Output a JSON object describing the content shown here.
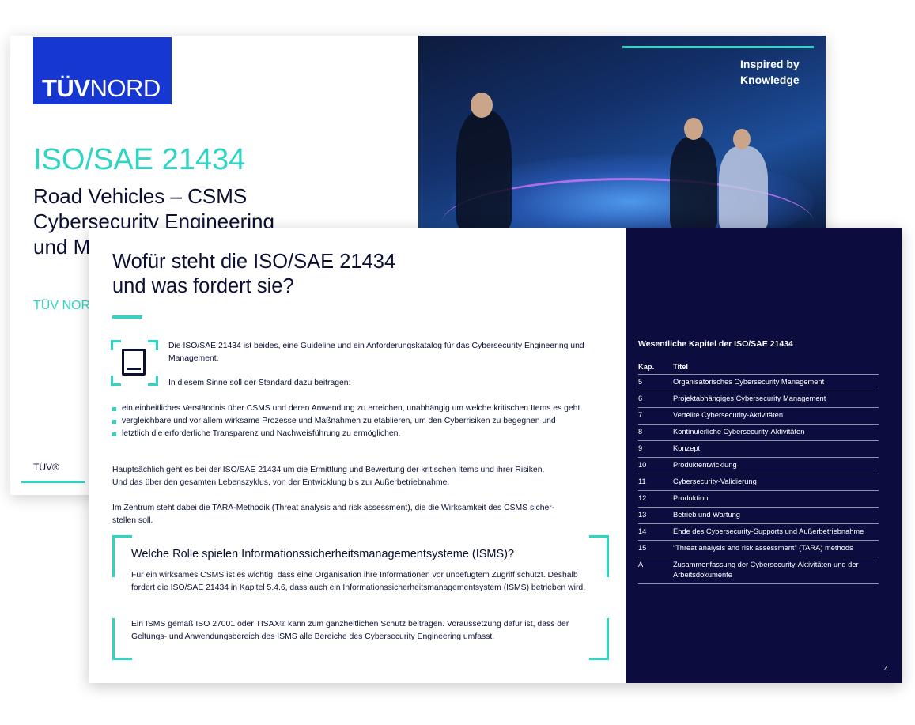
{
  "cover": {
    "logo_bold": "TÜV",
    "logo_regular": "NORD",
    "title": "ISO/SAE 21434",
    "subtitle_lines": [
      "Road Vehicles – CSMS",
      "Cybersecurity Engineering",
      "und M"
    ],
    "org_partial": "TÜV NOR",
    "footer": "TÜV®",
    "tagline_line1": "Inspired by",
    "tagline_line2": "Knowledge",
    "colors": {
      "accent": "#2fd4c3",
      "logo_blue": "#1737d2",
      "navy": "#0b0d3e"
    }
  },
  "page": {
    "heading_line1": "Wofür steht die ISO/SAE 21434",
    "heading_line2": "und was fordert sie?",
    "icon": "book-icon",
    "intro": "Die ISO/SAE 21434 ist beides, eine Guideline und ein Anforderungskatalog für das Cybersecurity Engineering und Management.",
    "lead": "In diesem Sinne soll der Standard dazu beitragen:",
    "bullets": [
      "ein einheitliches Verständnis über CSMS und deren Anwendung zu erreichen, unabhängig um welche kritischen Items es geht",
      "vergleichbare und vor allem wirksame Prozesse und Maßnahmen zu etablieren, um den Cyberrisiken zu begegnen und",
      "letztlich die erforderliche Transparenz und Nachweisführung zu ermöglichen."
    ],
    "para_main_line1": "Hauptsächlich geht es bei der ISO/SAE 21434 um die Ermittlung und Bewertung der kritischen Items und ihrer Risiken.",
    "para_main_line2": "Und das über den gesamten Lebenszyklus, von der Entwicklung bis zur Außerbetriebnahme.",
    "para_tara_line1": "Im Zentrum steht dabei die TARA-Methodik (Threat analysis and risk assessment), die die Wirksamkeit des CSMS sicher-",
    "para_tara_line2": "stellen soll.",
    "isms": {
      "heading": "Welche Rolle spielen Informationssicherheitsmanagementsysteme (ISMS)?",
      "text1": "Für ein wirksames CSMS ist es wichtig, dass eine Organisation ihre Informationen vor unbefugtem Zugriff schützt. Deshalb fordert die ISO/SAE 21434 in Kapitel 5.4.6, dass auch ein Informationssicherheitsmanagementsystem (ISMS) betrieben wird.",
      "text2": "Ein ISMS gemäß ISO 27001 oder TISAX® kann zum ganzheitlichen Schutz beitragen. Voraussetzung dafür ist, dass der Geltungs- und Anwendungsbereich des ISMS alle Bereiche des Cybersecurity Engineering umfasst."
    },
    "chapters": {
      "title": "Wesentliche Kapitel der ISO/SAE 21434",
      "col_kap": "Kap.",
      "col_titel": "Titel",
      "rows": [
        {
          "kap": "5",
          "titel": "Organisatorisches Cybersecurity Management"
        },
        {
          "kap": "6",
          "titel": "Projektabhängiges Cybersecurity Management"
        },
        {
          "kap": "7",
          "titel": "Verteilte Cybersecurity-Aktivitäten"
        },
        {
          "kap": "8",
          "titel": "Kontinuierliche Cybersecurity-Aktivitäten"
        },
        {
          "kap": "9",
          "titel": "Konzept"
        },
        {
          "kap": "10",
          "titel": "Produktentwicklung"
        },
        {
          "kap": "11",
          "titel": "Cybersecurity-Validierung"
        },
        {
          "kap": "12",
          "titel": "Produktion"
        },
        {
          "kap": "13",
          "titel": "Betrieb und Wartung"
        },
        {
          "kap": "14",
          "titel": "Ende des Cybersecurity-Supports und Außerbetriebnahme"
        },
        {
          "kap": "15",
          "titel": "“Threat analysis and risk assessment” (TARA) methods"
        },
        {
          "kap": "A",
          "titel": "Zusammenfassung der Cybersecurity-Aktivitäten und der Arbeitsdokumente"
        }
      ]
    },
    "page_number": "4"
  }
}
